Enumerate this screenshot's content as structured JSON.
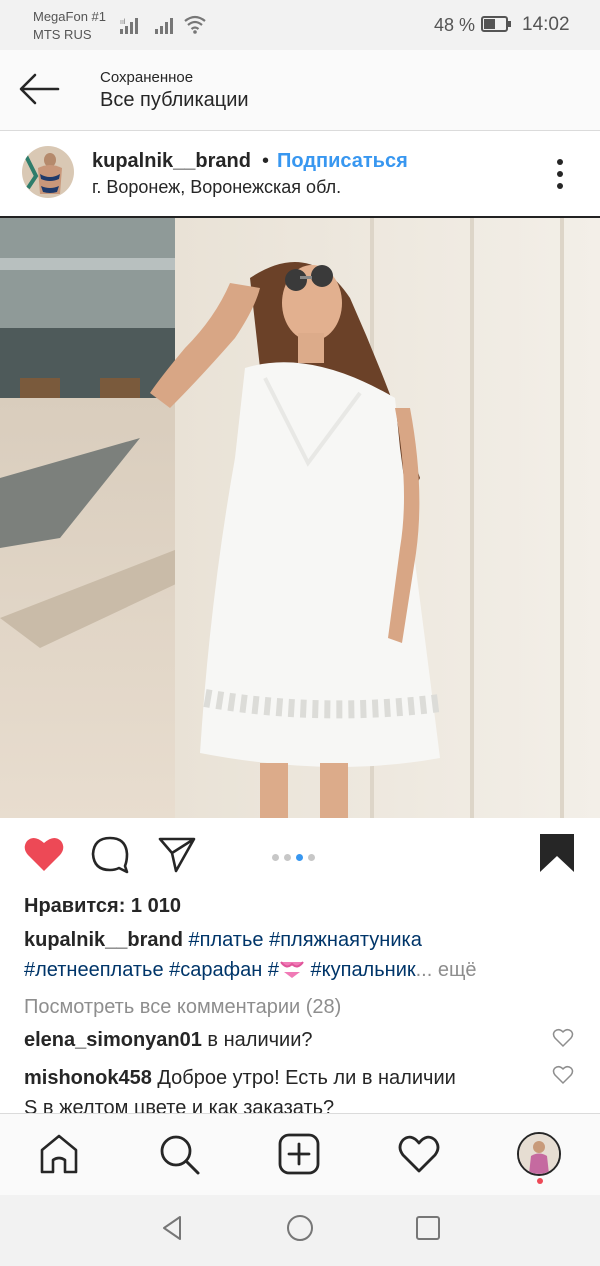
{
  "status_bar": {
    "carrier1": "MegaFon #1",
    "carrier2": "MTS RUS",
    "battery": "48 %",
    "time": "14:02"
  },
  "header": {
    "subtitle": "Сохраненное",
    "title": "Все публикации"
  },
  "post": {
    "username": "kupalnik__brand",
    "separator": "•",
    "follow_label": "Подписаться",
    "location": "г. Воронеж, Воронежская обл.",
    "likes": "Нравится: 1 010",
    "caption": {
      "user": "kupalnik__brand",
      "tags_line1": "#платье #пляжнаятуника",
      "tags_line2_a": "#летнееплатье #сарафан #",
      "tags_line2_b": " #купальник",
      "ellipsis": "...",
      "more": " ещё"
    },
    "view_comments": "Посмотреть все комментарии (28)",
    "comments": [
      {
        "user": "elena_simonyan01",
        "text": " в наличии?"
      },
      {
        "user": "mishonok458",
        "text": " Доброе утро! Есть ли в наличии",
        "text2": "S в желтом цвете и как заказать?"
      }
    ],
    "carousel": {
      "count": 4,
      "active": 3
    }
  },
  "colors": {
    "like": "#ed4956",
    "link": "#3897f0",
    "hashtag": "#003569",
    "muted": "#8e8e8e"
  },
  "icons": [
    "back-arrow-icon",
    "more-vertical-icon",
    "heart-filled-icon",
    "comment-icon",
    "share-icon",
    "bookmark-filled-icon",
    "home-icon",
    "search-icon",
    "add-post-icon",
    "activity-heart-icon"
  ]
}
